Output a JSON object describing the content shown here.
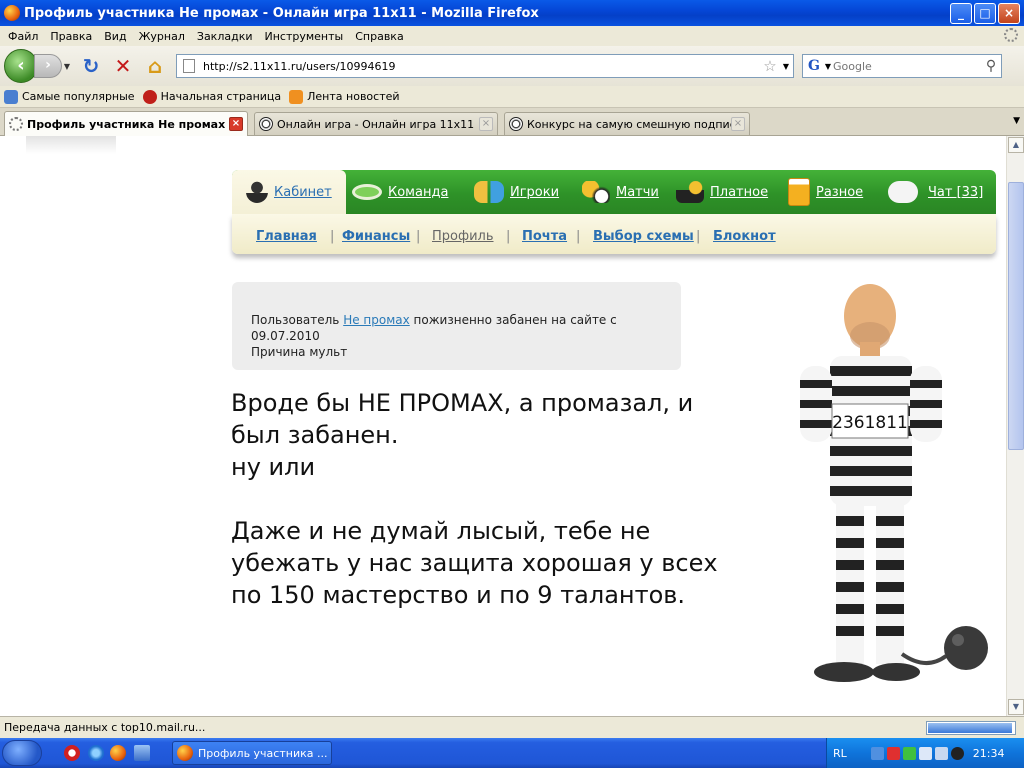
{
  "window": {
    "title": "Профиль участника Не промах - Онлайн игра 11x11 - Mozilla Firefox",
    "minimize": "_",
    "maximize": "□",
    "close": "×"
  },
  "menu": [
    "Файл",
    "Правка",
    "Вид",
    "Журнал",
    "Закладки",
    "Инструменты",
    "Справка"
  ],
  "nav": {
    "back": "‹",
    "forward": "›",
    "reload": "↻",
    "stop": "✕",
    "home": "⌂",
    "url": "http://s2.11x11.ru/users/10994619",
    "search_engine": "G",
    "search_placeholder": "Google"
  },
  "bookmarks": [
    {
      "label": "Самые популярные",
      "color": "#4a7fd0"
    },
    {
      "label": "Начальная страница",
      "color": "#c0201a"
    },
    {
      "label": "Лента новостей",
      "color": "#f09020"
    }
  ],
  "tabs": [
    {
      "label": "Профиль участника Не промах -...",
      "active": true
    },
    {
      "label": "Онлайн игра - Онлайн игра 11x11",
      "active": false
    },
    {
      "label": "Конкурс на самую смешную подпись ...",
      "active": false
    }
  ],
  "site_nav": {
    "main": [
      {
        "label": "Кабинет",
        "icon": "user-icon",
        "active": true
      },
      {
        "label": "Команда",
        "icon": "stadium-icon",
        "active": false
      },
      {
        "label": "Игроки",
        "icon": "players-icon",
        "active": false
      },
      {
        "label": "Матчи",
        "icon": "trophy-icon",
        "active": false
      },
      {
        "label": "Платное",
        "icon": "coins-icon",
        "active": false
      },
      {
        "label": "Разное",
        "icon": "beer-icon",
        "active": false
      },
      {
        "label": "Чат [33]",
        "icon": "chat-icon",
        "active": false
      }
    ],
    "sub": [
      {
        "label": "Главная",
        "current": false
      },
      {
        "label": "Финансы",
        "current": false
      },
      {
        "label": "Профиль",
        "current": true
      },
      {
        "label": "Почта",
        "current": false
      },
      {
        "label": "Выбор схемы",
        "current": false
      },
      {
        "label": "Блокнот",
        "current": false
      }
    ]
  },
  "ban": {
    "prefix": "Пользователь ",
    "username": "Не промах",
    "suffix": " пожизненно забанен на сайте с 09.07.2010",
    "reason": "Причина мульт"
  },
  "message": "Вроде бы НЕ ПРОМАХ, а промазал, и\nбыл забанен.\nну или\n\nДаже и не думай лысый, тебе не\nубежать у нас защита хорошая у всех\nпо 150 мастерство и по 9 талантов.",
  "prisoner": {
    "sign_number": "2361811"
  },
  "status": {
    "message": "Передача данных с top10.mail.ru...",
    "progress": 0.95
  },
  "taskbar": {
    "window_button": "Профиль участника ...",
    "lang": "RL",
    "clock": "21:34"
  }
}
